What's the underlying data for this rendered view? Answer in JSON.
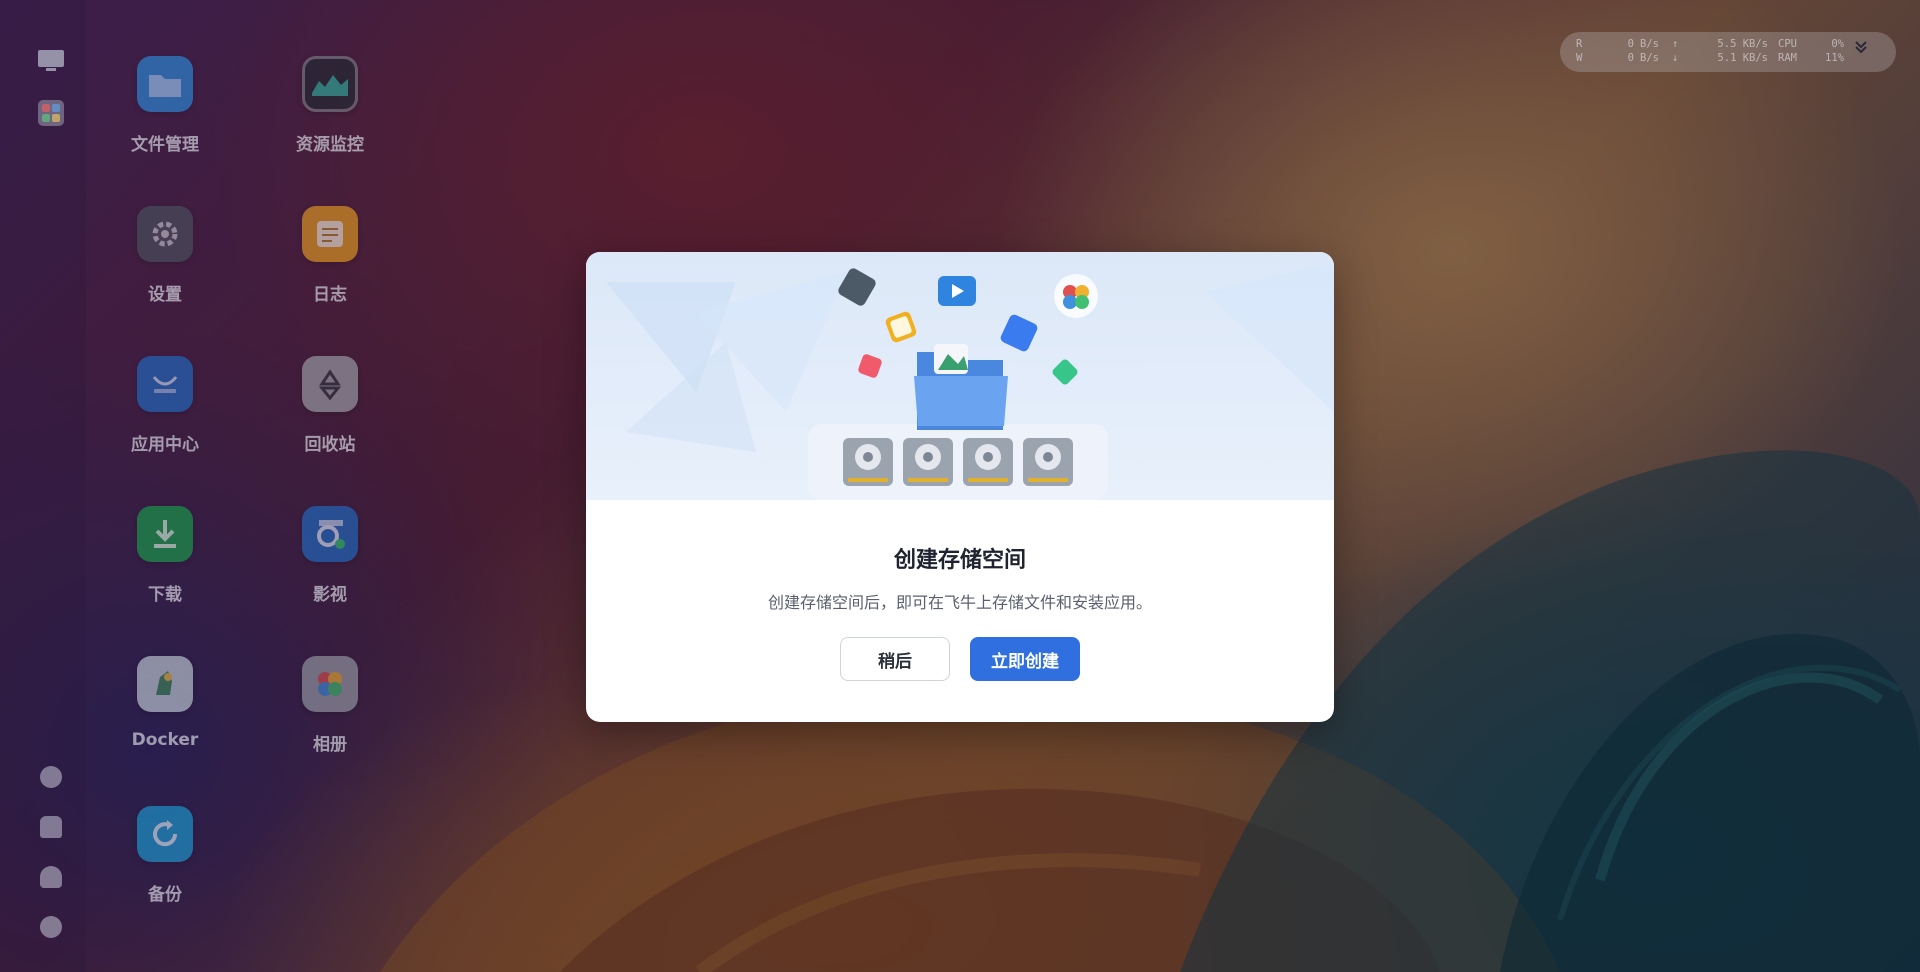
{
  "desktop": {
    "apps": [
      {
        "label": "文件管理",
        "icon": "folder-icon",
        "color": "#2a8fe0"
      },
      {
        "label": "资源监控",
        "icon": "monitor-icon",
        "color": "#1f2a33"
      },
      {
        "label": "设置",
        "icon": "gear-icon",
        "color": "#4a5560"
      },
      {
        "label": "日志",
        "icon": "log-icon",
        "color": "#e8a020"
      },
      {
        "label": "应用中心",
        "icon": "app-store-icon",
        "color": "#1e6fc8"
      },
      {
        "label": "回收站",
        "icon": "recycle-bin-icon",
        "color": "#a0a6ae"
      },
      {
        "label": "下载",
        "icon": "download-icon",
        "color": "#16a34a"
      },
      {
        "label": "影视",
        "icon": "video-icon",
        "color": "#1e6fc8"
      },
      {
        "label": "Docker",
        "icon": "docker-icon",
        "color": "#c8d4dc"
      },
      {
        "label": "相册",
        "icon": "photos-icon",
        "color": "#9aa0a8"
      },
      {
        "label": "备份",
        "icon": "backup-icon",
        "color": "#1aa0d8"
      }
    ]
  },
  "rail": {
    "top_icons": [
      "desktop-icon",
      "app-grid-icon"
    ],
    "bottom_icons": [
      "info-icon",
      "bell-icon",
      "user-icon",
      "settings-icon"
    ]
  },
  "sysmon": {
    "r_label": "R",
    "w_label": "W",
    "r_value": "0",
    "w_value": "0",
    "r_unit": "B/s",
    "w_unit": "B/s",
    "up_arrow": "↑",
    "down_arrow": "↓",
    "up_value": "5.5 KB/s",
    "down_value": "5.1 KB/s",
    "cpu_label": "CPU",
    "ram_label": "RAM",
    "cpu_value": "0%",
    "ram_value": "11%",
    "expand_icon": "chevron-double-down-icon"
  },
  "modal": {
    "title": "创建存储空间",
    "description": "创建存储空间后，即可在飞牛上存储文件和安装应用。",
    "later_label": "稍后",
    "create_label": "立即创建",
    "accent": "#2f6fe0"
  }
}
